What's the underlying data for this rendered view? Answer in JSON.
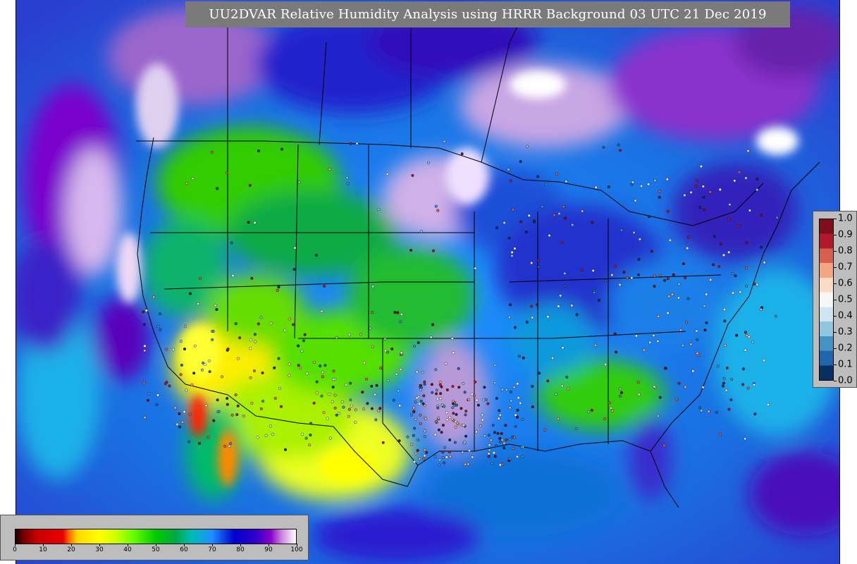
{
  "title": "UU2DVAR Relative Humidity Analysis using HRRR Background 03 UTC 21 Dec 2019",
  "rh_colorbar": {
    "ticks": [
      "0",
      "10",
      "20",
      "30",
      "40",
      "50",
      "60",
      "70",
      "80",
      "90",
      "100"
    ],
    "stops": [
      {
        "value": 0,
        "color": "#1a0000"
      },
      {
        "value": 3,
        "color": "#7a0000"
      },
      {
        "value": 8,
        "color": "#cc0000"
      },
      {
        "value": 17,
        "color": "#e60000"
      },
      {
        "value": 19,
        "color": "#ff6600"
      },
      {
        "value": 22,
        "color": "#ffd700"
      },
      {
        "value": 30,
        "color": "#ffff00"
      },
      {
        "value": 36,
        "color": "#ccff00"
      },
      {
        "value": 42,
        "color": "#66ff00"
      },
      {
        "value": 50,
        "color": "#00cc00"
      },
      {
        "value": 57,
        "color": "#00aa44"
      },
      {
        "value": 63,
        "color": "#00bbbb"
      },
      {
        "value": 70,
        "color": "#1e90ff"
      },
      {
        "value": 78,
        "color": "#0000cc"
      },
      {
        "value": 86,
        "color": "#3300cc"
      },
      {
        "value": 91,
        "color": "#8800cc"
      },
      {
        "value": 95,
        "color": "#cc88dd"
      },
      {
        "value": 100,
        "color": "#ffffff"
      }
    ]
  },
  "increment_colorbar": {
    "ticks": [
      "1.0",
      "0.9",
      "0.8",
      "0.7",
      "0.6",
      "0.5",
      "0.4",
      "0.3",
      "0.2",
      "0.1",
      "0.0"
    ],
    "colors": [
      "#7f0d1b",
      "#b2182b",
      "#d6604d",
      "#f4a582",
      "#fddbc7",
      "#f7f7f7",
      "#d1e5f0",
      "#92c5de",
      "#4393c3",
      "#2166ac",
      "#053061"
    ]
  },
  "colors": {
    "ocean": "#1f7fd8",
    "dry": "#ffff00",
    "moist": "#00cc00",
    "humid": "#0000cc",
    "saturated": "#8800cc"
  }
}
